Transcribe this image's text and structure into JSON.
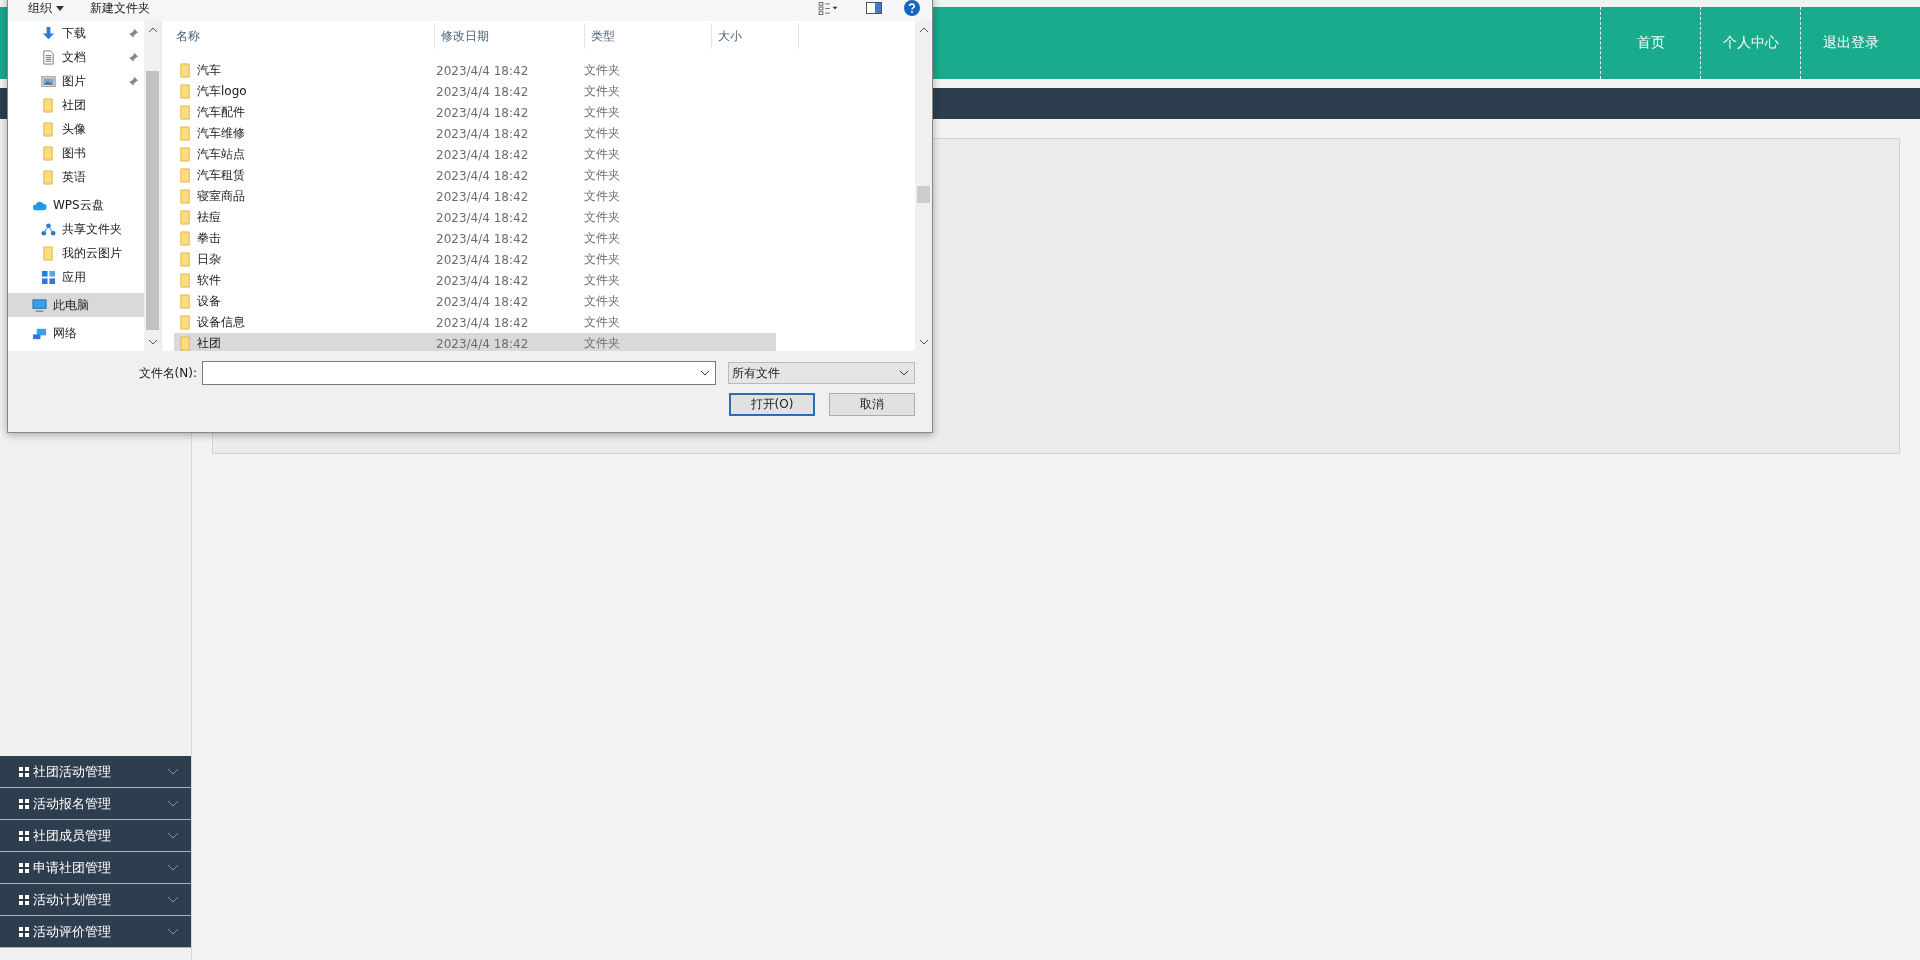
{
  "page": {
    "header": {
      "nav": [
        {
          "label": "首页"
        },
        {
          "label": "个人中心"
        },
        {
          "label": "退出登录"
        }
      ]
    },
    "sidebar": {
      "menu": [
        {
          "label": "社团活动管理"
        },
        {
          "label": "活动报名管理"
        },
        {
          "label": "社团成员管理"
        },
        {
          "label": "申请社团管理"
        },
        {
          "label": "活动计划管理"
        },
        {
          "label": "活动评价管理"
        }
      ]
    }
  },
  "dialog": {
    "toolbar": {
      "organize": "组织",
      "new_folder": "新建文件夹"
    },
    "nav": [
      {
        "label": "下载",
        "kind": "download",
        "pinned": true,
        "selected": false
      },
      {
        "label": "文档",
        "kind": "document",
        "pinned": true,
        "selected": false
      },
      {
        "label": "图片",
        "kind": "picture",
        "pinned": true,
        "selected": false
      },
      {
        "label": "社团",
        "kind": "folder",
        "pinned": false,
        "selected": false
      },
      {
        "label": "头像",
        "kind": "folder",
        "pinned": false,
        "selected": false
      },
      {
        "label": "图书",
        "kind": "folder",
        "pinned": false,
        "selected": false
      },
      {
        "label": "英语",
        "kind": "folder",
        "pinned": false,
        "selected": false
      },
      {
        "label": "WPS云盘",
        "kind": "cloud",
        "pinned": false,
        "selected": false
      },
      {
        "label": "共享文件夹",
        "kind": "share",
        "pinned": false,
        "selected": false
      },
      {
        "label": "我的云图片",
        "kind": "folder",
        "pinned": false,
        "selected": false
      },
      {
        "label": "应用",
        "kind": "apps",
        "pinned": false,
        "selected": false
      },
      {
        "label": "此电脑",
        "kind": "pc",
        "pinned": false,
        "selected": true
      },
      {
        "label": "网络",
        "kind": "network",
        "pinned": false,
        "selected": false
      }
    ],
    "columns": [
      "名称",
      "修改日期",
      "类型",
      "大小"
    ],
    "rows": [
      {
        "name": "汽车",
        "date": "2023/4/4 18:42",
        "type": "文件夹",
        "selected": false
      },
      {
        "name": "汽车logo",
        "date": "2023/4/4 18:42",
        "type": "文件夹",
        "selected": false
      },
      {
        "name": "汽车配件",
        "date": "2023/4/4 18:42",
        "type": "文件夹",
        "selected": false
      },
      {
        "name": "汽车维修",
        "date": "2023/4/4 18:42",
        "type": "文件夹",
        "selected": false
      },
      {
        "name": "汽车站点",
        "date": "2023/4/4 18:42",
        "type": "文件夹",
        "selected": false
      },
      {
        "name": "汽车租赁",
        "date": "2023/4/4 18:42",
        "type": "文件夹",
        "selected": false
      },
      {
        "name": "寝室商品",
        "date": "2023/4/4 18:42",
        "type": "文件夹",
        "selected": false
      },
      {
        "name": "祛痘",
        "date": "2023/4/4 18:42",
        "type": "文件夹",
        "selected": false
      },
      {
        "name": "拳击",
        "date": "2023/4/4 18:42",
        "type": "文件夹",
        "selected": false
      },
      {
        "name": "日杂",
        "date": "2023/4/4 18:42",
        "type": "文件夹",
        "selected": false
      },
      {
        "name": "软件",
        "date": "2023/4/4 18:42",
        "type": "文件夹",
        "selected": false
      },
      {
        "name": "设备",
        "date": "2023/4/4 18:42",
        "type": "文件夹",
        "selected": false
      },
      {
        "name": "设备信息",
        "date": "2023/4/4 18:42",
        "type": "文件夹",
        "selected": false
      },
      {
        "name": "社团",
        "date": "2023/4/4 18:42",
        "type": "文件夹",
        "selected": true
      }
    ],
    "filename_label": "文件名(N):",
    "filter": "所有文件",
    "buttons": [
      {
        "label": "打开(O)",
        "default": true
      },
      {
        "label": "取消",
        "default": false
      }
    ]
  }
}
